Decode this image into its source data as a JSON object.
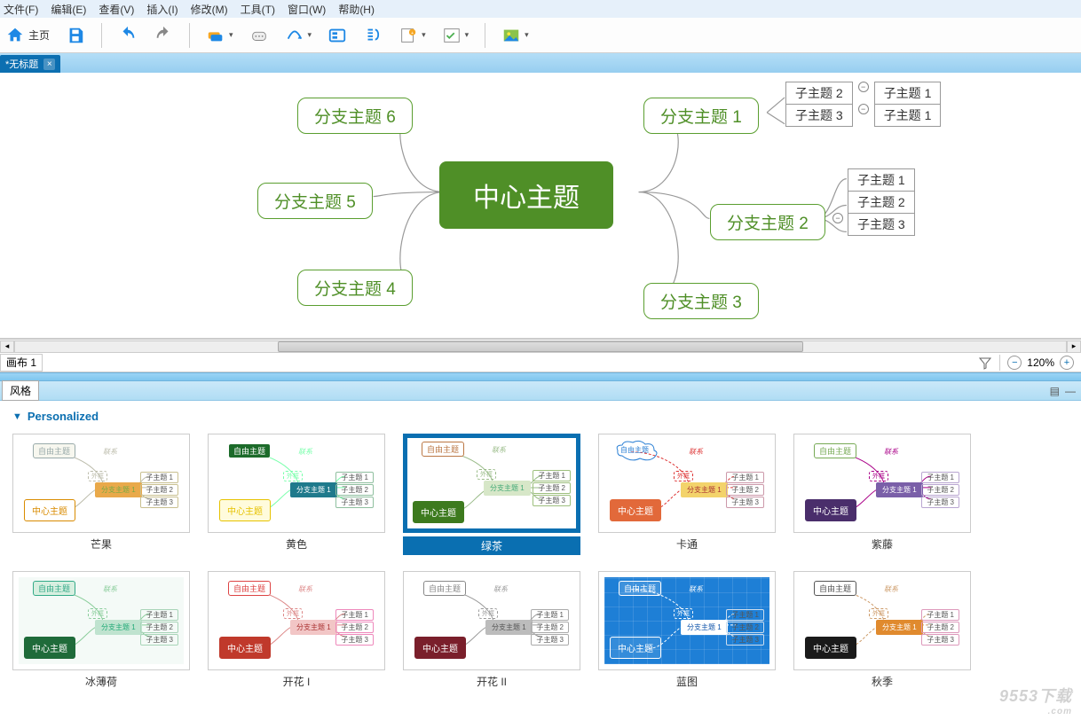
{
  "menu": {
    "file": "文件(F)",
    "edit": "编辑(E)",
    "view": "查看(V)",
    "insert": "插入(I)",
    "modify": "修改(M)",
    "tools": "工具(T)",
    "window": "窗口(W)",
    "help": "帮助(H)"
  },
  "toolbar": {
    "home": "主页"
  },
  "tab": {
    "title": "*无标题",
    "close": "×"
  },
  "map": {
    "center": "中心主题",
    "branches": {
      "b1": "分支主题 1",
      "b2": "分支主题 2",
      "b3": "分支主题 3",
      "b4": "分支主题 4",
      "b5": "分支主题 5",
      "b6": "分支主题 6"
    },
    "b1subs_top": {
      "r1a": "子主题 2",
      "r1b": "子主题 1",
      "r2a": "子主题 3",
      "r2b": "子主题 1"
    },
    "b2subs": {
      "s1": "子主题 1",
      "s2": "子主题 2",
      "s3": "子主题 3"
    }
  },
  "status": {
    "canvas": "画布 1",
    "zoom": "120%"
  },
  "stylePanel": {
    "title": "风格",
    "section": "Personalized"
  },
  "mini": {
    "free": "自由主题",
    "rel": "联系",
    "center": "中心主题",
    "branch": "分支主题 1",
    "s1": "子主题 1",
    "s2": "子主题 2",
    "s3": "子主题 3",
    "cartoon_free": "自由主题",
    "ext": "外框"
  },
  "themes": [
    {
      "name": "芒果",
      "sel": false,
      "bg": "#ffffff",
      "free": "#9aa",
      "freeBg": "#f7f7ef",
      "center": "#d98b00",
      "centerBg": "#fff",
      "centerBorder": "#d98b00",
      "branch": "#e9a94a",
      "branchText": "#7a4",
      "sub": "#c9c090",
      "line": "#bba"
    },
    {
      "name": "黄色",
      "sel": false,
      "bg": "#ffffff",
      "free": "#fff",
      "freeBg": "#1c6b2a",
      "center": "#e6c200",
      "centerBg": "#fffbdc",
      "centerBorder": "#e6c200",
      "branch": "#1f7a8c",
      "branchText": "#fff",
      "sub": "#8fbf9f",
      "line": "#7fa"
    },
    {
      "name": "绿茶",
      "sel": true,
      "bg": "#ffffff",
      "free": "#b74",
      "freeBg": "#fff",
      "center": "#fff",
      "centerBg": "#3d7a1e",
      "centerBorder": "#3d7a1e",
      "branch": "#d7e7c8",
      "branchText": "#4a7",
      "sub": "#9dbf7d",
      "line": "#9b8"
    },
    {
      "name": "卡通",
      "sel": false,
      "bg": "#ffffff",
      "free": "#2a7fd4",
      "freeBg": "#eaf4ff",
      "center": "#fff",
      "centerBg": "#e2693a",
      "centerBorder": "#e2693a",
      "branch": "#f3d36b",
      "branchText": "#a33",
      "sub": "#c9a",
      "line": "#d33",
      "dashed": true,
      "cloud": true
    },
    {
      "name": "紫藤",
      "sel": false,
      "bg": "#ffffff",
      "free": "#7a5",
      "freeBg": "#fff",
      "center": "#fff",
      "centerBg": "#4a2e6b",
      "centerBorder": "#4a2e6b",
      "branch": "#7a5fa8",
      "branchText": "#fff",
      "sub": "#b9a6d1",
      "line": "#a08"
    },
    {
      "name": "冰薄荷",
      "sel": false,
      "bg": "#f4faf7",
      "free": "#3a8",
      "freeBg": "#d7efe0",
      "center": "#fff",
      "centerBg": "#1f6b3a",
      "centerBorder": "#1f6b3a",
      "branch": "#bfe3cf",
      "branchText": "#2a7",
      "sub": "#a8d4b8",
      "line": "#8c9"
    },
    {
      "name": "开花 I",
      "sel": false,
      "bg": "#ffffff",
      "free": "#d44",
      "freeBg": "#fff",
      "center": "#fff",
      "centerBg": "#c0392b",
      "centerBorder": "#c0392b",
      "branch": "#f2c6c6",
      "branchText": "#a33",
      "sub": "#e8b",
      "line": "#d88"
    },
    {
      "name": "开花 II",
      "sel": false,
      "bg": "#ffffff",
      "free": "#888",
      "freeBg": "#fff",
      "center": "#fff",
      "centerBg": "#7a1f2b",
      "centerBorder": "#7a1f2b",
      "branch": "#bcbcbc",
      "branchText": "#555",
      "sub": "#aaa",
      "line": "#999"
    },
    {
      "name": "蓝图",
      "sel": false,
      "bg": "#1e7fd6",
      "free": "#fff",
      "freeBg": "rgba(255,255,255,.15)",
      "center": "#fff",
      "centerBg": "rgba(255,255,255,.1)",
      "centerBorder": "#fff",
      "branch": "#fff",
      "branchText": "#15a",
      "sub": "#cde",
      "line": "#fff",
      "dashed": true,
      "blueprint": true
    },
    {
      "name": "秋季",
      "sel": false,
      "bg": "#ffffff",
      "free": "#555",
      "freeBg": "#fff",
      "center": "#fff",
      "centerBg": "#1a1a1a",
      "centerBorder": "#1a1a1a",
      "branch": "#e08a2e",
      "branchText": "#fff",
      "sub": "#d9b",
      "line": "#c96",
      "dashed": true
    }
  ],
  "watermark": {
    "main": "9553下载",
    "sub": ".com"
  }
}
